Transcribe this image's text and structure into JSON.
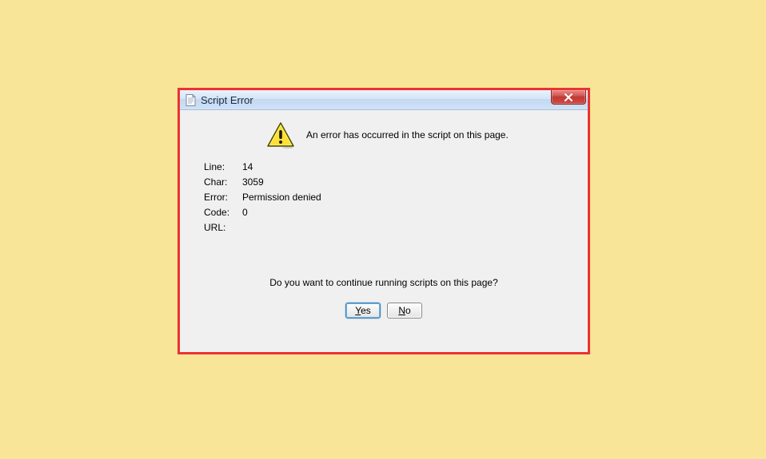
{
  "dialog": {
    "title": "Script Error",
    "message": "An error has occurred in the script on this page.",
    "details": {
      "line_label": "Line:",
      "line_value": "14",
      "char_label": "Char:",
      "char_value": "3059",
      "error_label": "Error:",
      "error_value": "Permission denied",
      "code_label": "Code:",
      "code_value": "0",
      "url_label": "URL:",
      "url_value": ""
    },
    "prompt": "Do you want to continue running scripts on this page?",
    "yes_u": "Y",
    "yes_rest": "es",
    "no_u": "N",
    "no_rest": "o"
  }
}
